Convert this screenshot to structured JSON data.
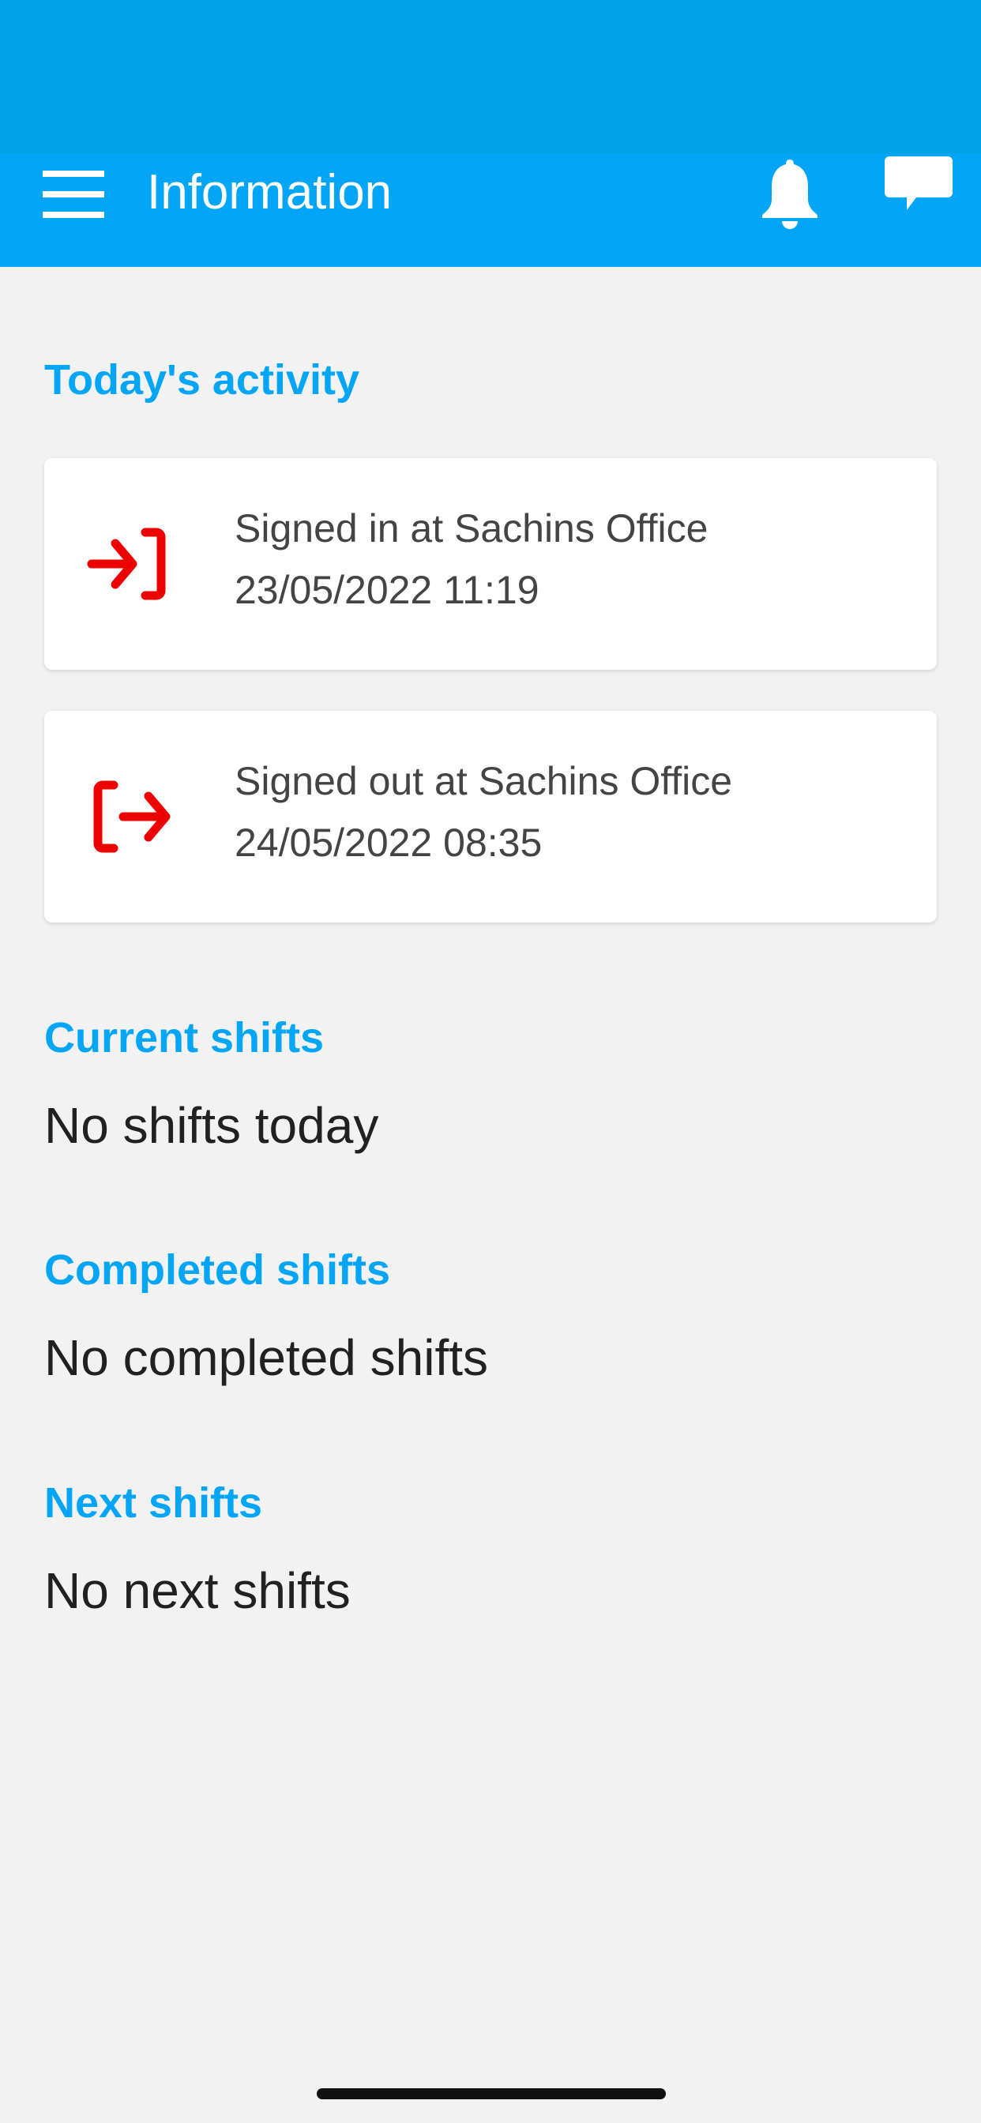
{
  "header": {
    "title": "Information",
    "menu_icon": "hamburger-icon",
    "notification_icon": "bell-icon",
    "messages_icon": "chat-bubble-icon"
  },
  "colors": {
    "accent": "#03a5f7",
    "icon_red": "#ee0000"
  },
  "activity": {
    "heading": "Today's activity",
    "items": [
      {
        "icon": "sign-in-icon",
        "text": "Signed in at Sachins Office",
        "time": "23/05/2022 11:19"
      },
      {
        "icon": "sign-out-icon",
        "text": "Signed out at Sachins Office",
        "time": "24/05/2022 08:35"
      }
    ]
  },
  "current": {
    "heading": "Current shifts",
    "text": "No shifts today"
  },
  "completed": {
    "heading": "Completed shifts",
    "text": "No completed shifts"
  },
  "next": {
    "heading": "Next shifts",
    "text": "No next shifts"
  }
}
